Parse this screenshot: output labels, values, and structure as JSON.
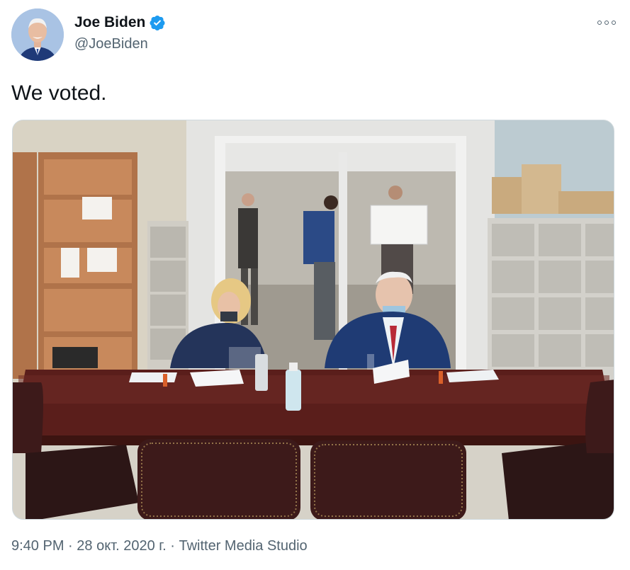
{
  "author": {
    "display_name": "Joe Biden",
    "handle": "@JoeBiden",
    "verified": true,
    "avatar_icon": "profile-photo"
  },
  "tweet": {
    "text": "We voted.",
    "media_icon": "photo-couple-signing-ballots"
  },
  "meta": {
    "time": "9:40 PM",
    "separator": " · ",
    "date": "28 окт. 2020 г.",
    "source": "Twitter Media Studio"
  },
  "colors": {
    "verified_blue": "#1d9bf0",
    "secondary_text": "#536471",
    "primary_text": "#0f1419"
  }
}
